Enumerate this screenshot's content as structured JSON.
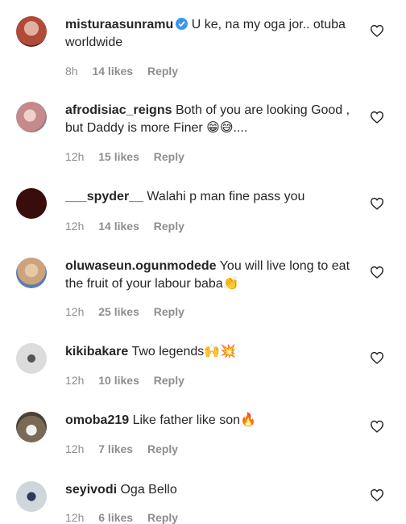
{
  "comments": [
    {
      "user": "misturaasunramu",
      "verified": true,
      "text": "U ke, na my oga jor.. otuba worldwide",
      "time": "8h",
      "likes": "14 likes",
      "reply": "Reply",
      "avatar_color": "#b04a3a"
    },
    {
      "user": "afrodisiac_reigns",
      "verified": false,
      "text": "Both of you are looking Good , but Daddy is more Finer 😁😅....",
      "time": "12h",
      "likes": "15 likes",
      "reply": "Reply",
      "avatar_color": "#c48a8c"
    },
    {
      "user": "___spyder__",
      "verified": false,
      "text": "Walahi p man fine pass you",
      "time": "12h",
      "likes": "14 likes",
      "reply": "Reply",
      "avatar_color": "#3a0d0d"
    },
    {
      "user": "oluwaseun.ogunmodede",
      "verified": false,
      "text": "You will live long to eat the fruit of your labour baba👏",
      "time": "12h",
      "likes": "25 likes",
      "reply": "Reply",
      "avatar_color": "#c9a47c"
    },
    {
      "user": "kikibakare",
      "verified": false,
      "text": "Two legends🙌💥",
      "time": "12h",
      "likes": "10 likes",
      "reply": "Reply",
      "avatar_color": "#d8d8d8"
    },
    {
      "user": "omoba219",
      "verified": false,
      "text": "Like father like son🔥",
      "time": "12h",
      "likes": "7 likes",
      "reply": "Reply",
      "avatar_color": "#7a6a55"
    },
    {
      "user": "seyivodi",
      "verified": false,
      "text": "Oga Bello",
      "time": "12h",
      "likes": "6 likes",
      "reply": "Reply",
      "avatar_color": "#cfd6dc"
    }
  ]
}
